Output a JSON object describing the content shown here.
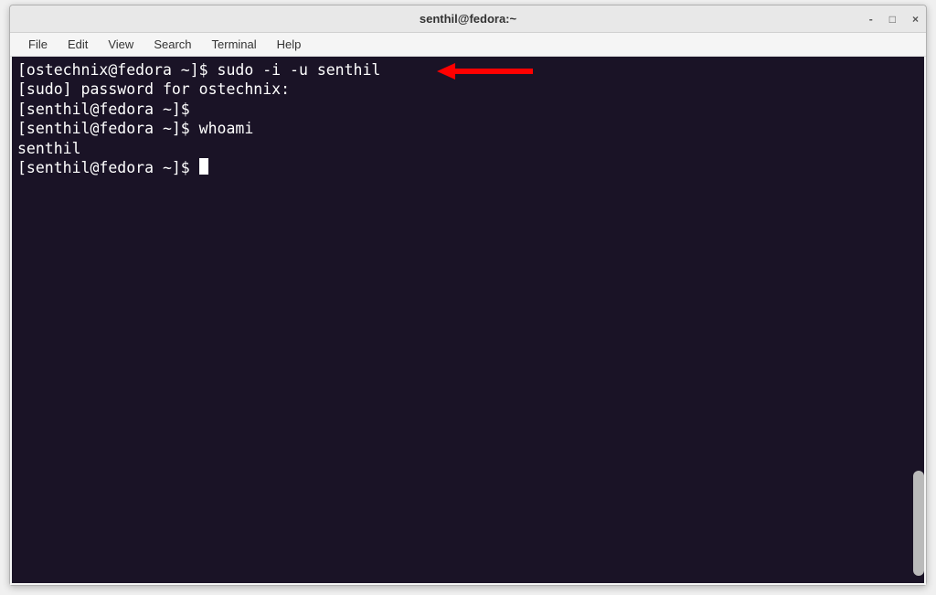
{
  "titlebar": {
    "title": "senthil@fedora:~"
  },
  "window_controls": {
    "minimize": "-",
    "maximize": "□",
    "close": "×"
  },
  "menubar": {
    "items": [
      {
        "label": "File"
      },
      {
        "label": "Edit"
      },
      {
        "label": "View"
      },
      {
        "label": "Search"
      },
      {
        "label": "Terminal"
      },
      {
        "label": "Help"
      }
    ]
  },
  "terminal": {
    "lines": [
      "[ostechnix@fedora ~]$ sudo -i -u senthil",
      "[sudo] password for ostechnix:",
      "[senthil@fedora ~]$",
      "[senthil@fedora ~]$ whoami",
      "senthil",
      "[senthil@fedora ~]$ "
    ]
  }
}
